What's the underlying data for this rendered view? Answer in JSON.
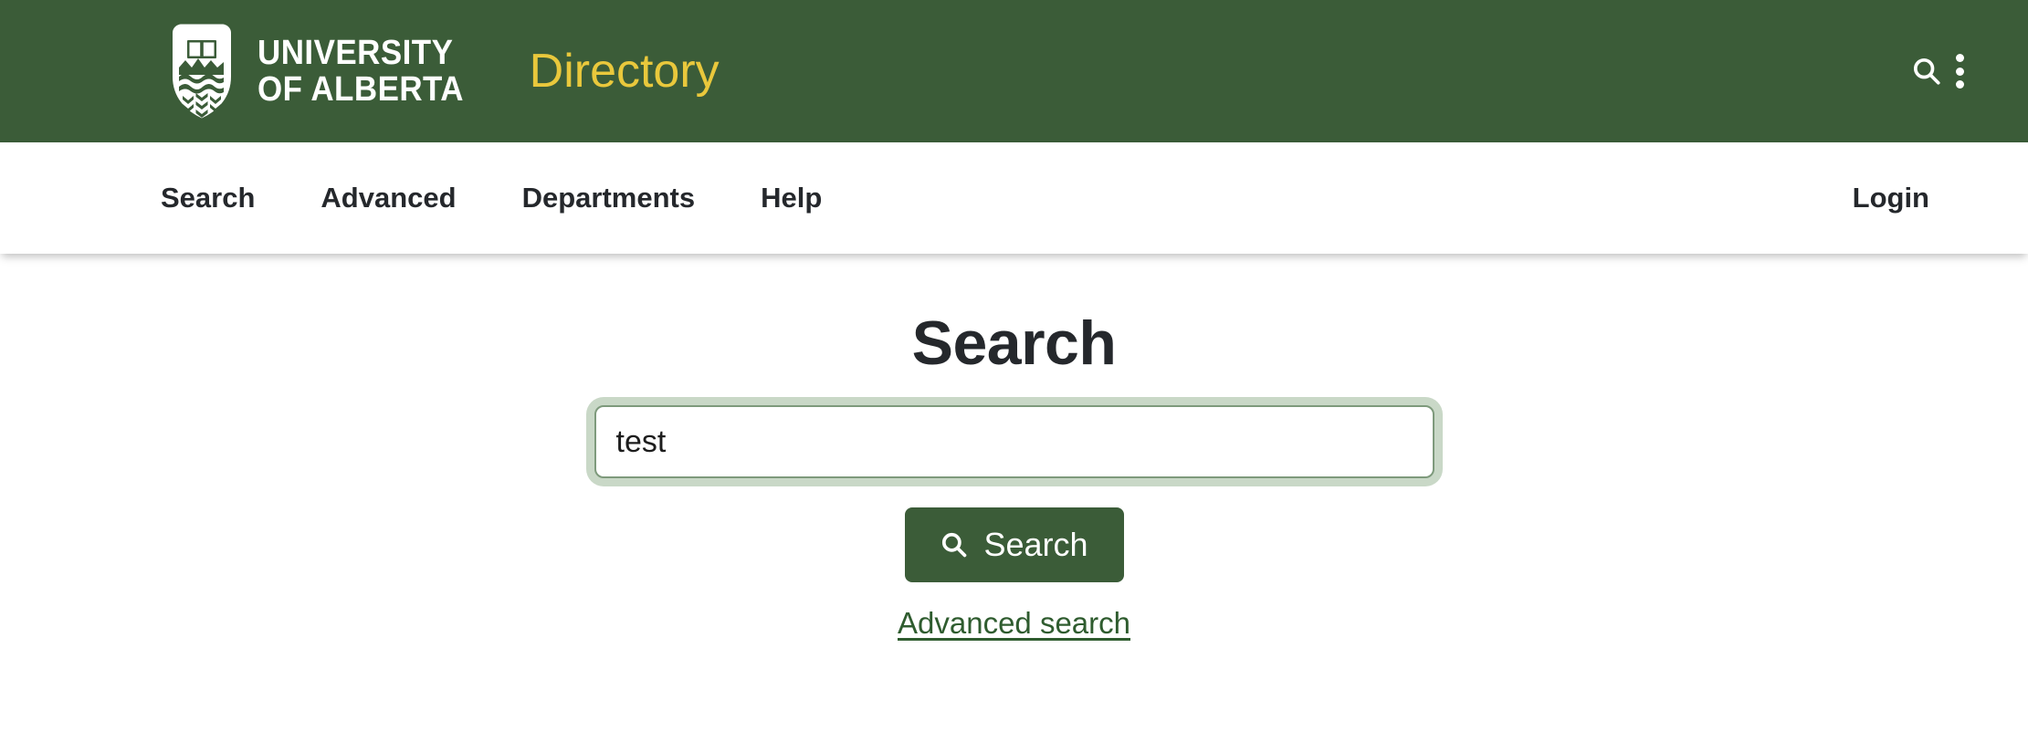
{
  "brand": {
    "logo_line1": "UNIVERSITY",
    "logo_line2": "OF ALBERTA",
    "logo_icon": "ualberta-shield-icon",
    "app_title": "Directory",
    "app_title_color": "#e9c83c",
    "bar_color": "#3b5c38",
    "search_icon": "search-icon",
    "menu_icon": "kebab-menu-icon"
  },
  "nav": {
    "items": [
      {
        "label": "Search"
      },
      {
        "label": "Advanced"
      },
      {
        "label": "Departments"
      },
      {
        "label": "Help"
      }
    ],
    "login_label": "Login"
  },
  "main": {
    "title": "Search",
    "search": {
      "value": "test",
      "placeholder": "",
      "button_label": "Search",
      "button_icon": "search-icon",
      "button_color": "#3b5c38",
      "focus_ring_color": "#c9d8c7",
      "border_color": "#7e9a7c"
    },
    "advanced_link_label": "Advanced search",
    "link_color": "#2f5c2f"
  }
}
